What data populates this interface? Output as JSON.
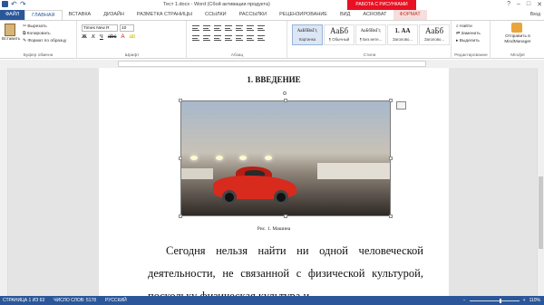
{
  "titlebar": {
    "title": "Тест 1.docx - Word (Сбой активации продукта)",
    "work_tab": "РАБОТА С РИСУНКАМИ",
    "min": "–",
    "max": "□",
    "close": "✕",
    "help": "?"
  },
  "tabs": {
    "file": "ФАЙЛ",
    "home": "ГЛАВНАЯ",
    "insert": "ВСТАВКА",
    "design": "ДИЗАЙН",
    "layout": "РАЗМЕТКА СТРАНИЦЫ",
    "references": "ССЫЛКИ",
    "mailings": "РАССЫЛКИ",
    "review": "РЕЦЕНЗИРОВАНИЕ",
    "view": "ВИД",
    "acrobat": "ACROBAT",
    "format": "ФОРМАТ",
    "user": "Вход"
  },
  "ribbon": {
    "clipboard": {
      "paste": "Вставить",
      "cut": "Вырезать",
      "copy": "Копировать",
      "format_painter": "Формат по образцу",
      "label": "Буфер обмена"
    },
    "font": {
      "name": "Times New R",
      "size": "10",
      "label": "Шрифт"
    },
    "paragraph": {
      "label": "Абзац"
    },
    "styles": {
      "label": "Стили",
      "items": [
        {
          "sample": "АаБбВвГг,",
          "name": "Картинка"
        },
        {
          "sample": "АаБб",
          "name": "¶ Обычный"
        },
        {
          "sample": "АаБбВвГг,",
          "name": "¶ Без инте..."
        },
        {
          "sample": "1. АА",
          "name": "Заголово..."
        },
        {
          "sample": "АаБб",
          "name": "Заголово..."
        }
      ]
    },
    "editing": {
      "find": "Найти",
      "replace": "Заменить",
      "select": "Выделить",
      "label": "Редактирование"
    },
    "mindjet": {
      "send": "Отправить в",
      "target": "MindManager",
      "label": "Mindjet"
    }
  },
  "document": {
    "heading": "1. ВВЕДЕНИЕ",
    "caption": "Рис. 1. Машина",
    "body": "Сегодня нельзя найти ни одной человеческой деятельности, не связанной с физической культурой, поскольку физическая культура и"
  },
  "status": {
    "page": "СТРАНИЦА 1 ИЗ 63",
    "words": "ЧИСЛО СЛОВ: 5178",
    "lang": "РУССКИЙ",
    "zoom": "110%",
    "zoom_value": 110
  }
}
